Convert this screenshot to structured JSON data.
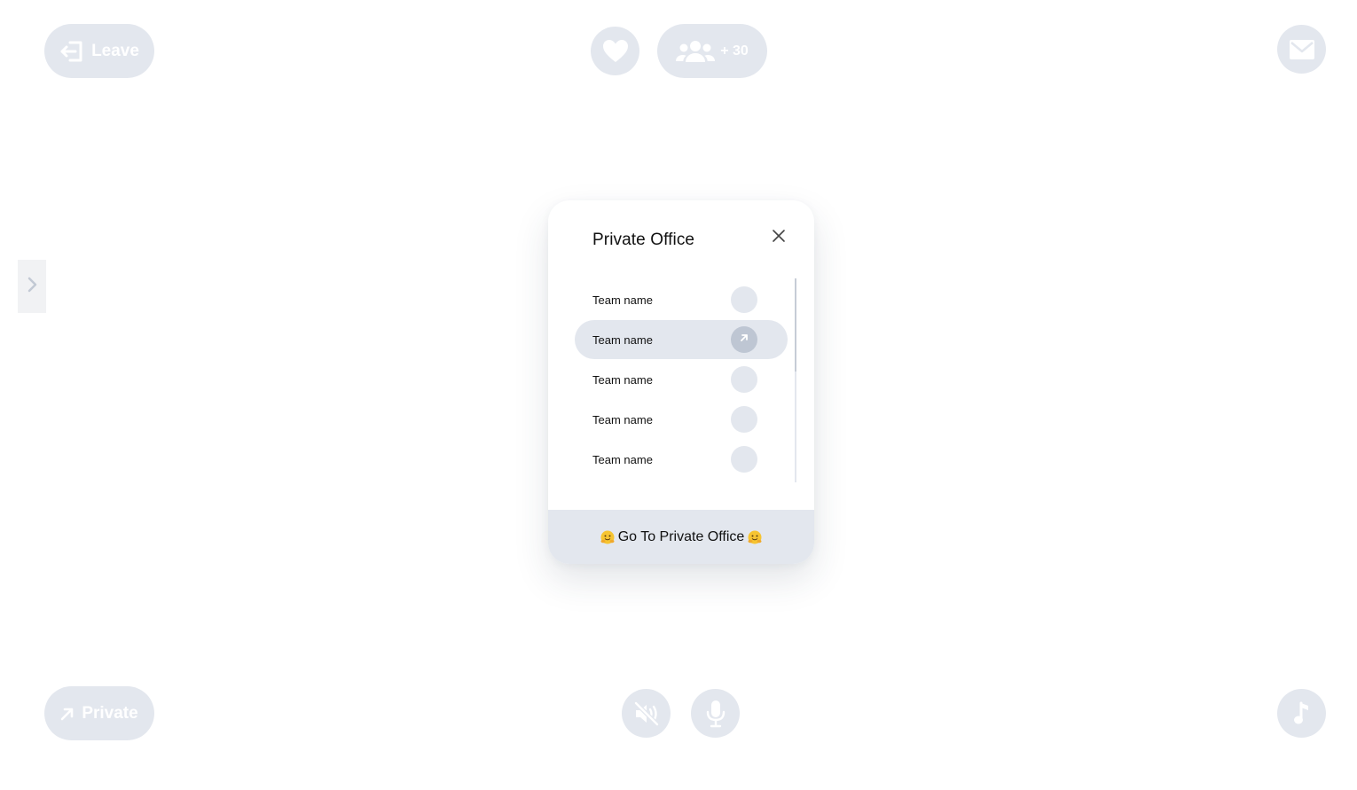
{
  "top_bar": {
    "leave_label": "Leave",
    "people_count": "+ 30",
    "icons": {
      "leave": "leave-icon",
      "heart": "heart-icon",
      "people": "people-icon",
      "mail": "mail-icon"
    }
  },
  "bottom_bar": {
    "private_label": "Private",
    "icons": {
      "private": "arrow-up-right-icon",
      "sound": "speaker-muted-icon",
      "mic": "microphone-icon",
      "music": "music-note-icon"
    }
  },
  "sidebar_toggle": {
    "icon": "chevron-right-icon"
  },
  "modal": {
    "title": "Private Office",
    "teams": [
      {
        "label": "Team name",
        "active": false
      },
      {
        "label": "Team name",
        "active": true
      },
      {
        "label": "Team name",
        "active": false
      },
      {
        "label": "Team name",
        "active": false
      },
      {
        "label": "Team name",
        "active": false
      }
    ],
    "action_label": "Go To Private Office",
    "action_emoji": "hugging-face-icon"
  },
  "colors": {
    "button_bg": "#e3e7ee",
    "active_dot": "#bec6d3",
    "text": "#111111",
    "icon": "#ffffff"
  }
}
